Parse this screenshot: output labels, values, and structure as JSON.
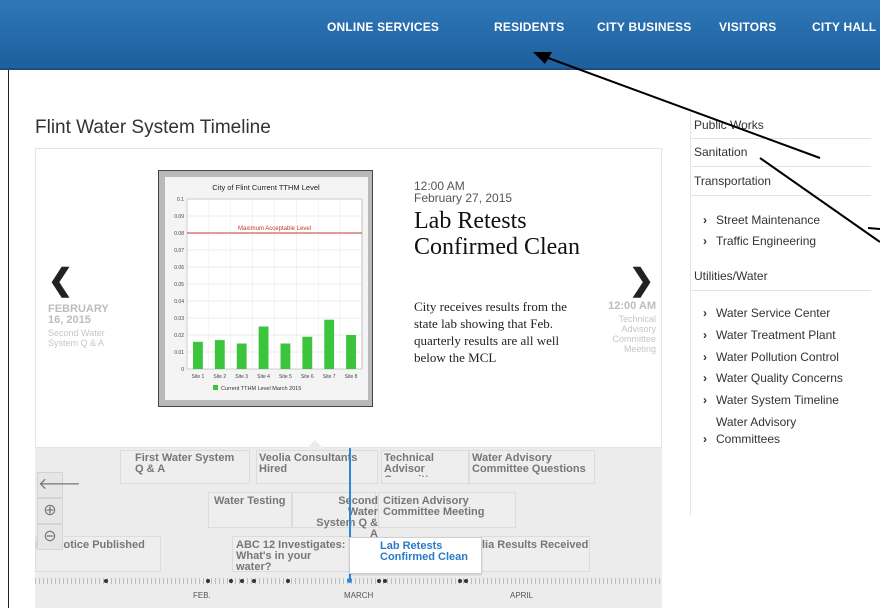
{
  "nav": {
    "items": [
      "ONLINE SERVICES",
      "RESIDENTS",
      "CITY BUSINESS",
      "VISITORS",
      "CITY HALL"
    ]
  },
  "page": {
    "title": "Flint Water System Timeline"
  },
  "slide": {
    "prev": {
      "month_day": "FEBRUARY",
      "year": "16, 2015",
      "caption": "Second Water\nSystem Q & A"
    },
    "next": {
      "time": "12:00 AM",
      "caption": "Technical\nAdvisory\nCommittee\nMeeting"
    },
    "time": "12:00 AM",
    "date": "February 27, 2015",
    "heading": "Lab Retests Confirmed Clean",
    "body": "City receives results from the state lab showing that Feb. quarterly results are all well below the MCL"
  },
  "chart_data": {
    "type": "bar",
    "title": "City of Flint     Current TTHM Level",
    "categories": [
      "Site 1",
      "Site 2",
      "Site 3",
      "Site 4",
      "Site 5",
      "Site 6",
      "Site 7",
      "Site 8"
    ],
    "values": [
      0.016,
      0.017,
      0.015,
      0.025,
      0.015,
      0.019,
      0.029,
      0.02
    ],
    "ylim": [
      0,
      0.1
    ],
    "yticks": [
      "0",
      "0.01",
      "0.02",
      "0.03",
      "0.04",
      "0.05",
      "0.06",
      "0.07",
      "0.08",
      "0.09",
      "0.1"
    ],
    "reference_line": {
      "value": 0.08,
      "label": "Maximum Acceptable Level",
      "color": "#c0392b"
    },
    "series": [
      {
        "name": "Current TTHM Level March 2015",
        "color": "#3cc53c"
      }
    ],
    "legend_label": "Current TTHM Level March 2015",
    "grid": true
  },
  "timeline": {
    "events": [
      "First Water System Q & A",
      "Veolia Consultants Hired",
      "Technical Advisor Committee Meetin",
      "Water Advisory Committee Questions",
      "Water Testing",
      "Second Water System Q & A",
      "Citizen Advisory Committee Meeting",
      "ion Notice Published",
      "ABC 12 Investigates: What's in your water?",
      "lia Results Received"
    ],
    "active_event": "Lab Retests Confirmed Clean",
    "months": [
      "FEB.",
      "MARCH",
      "APRIL"
    ]
  },
  "sidebar": {
    "sections": [
      "Public Works",
      "Sanitation",
      "Transportation"
    ],
    "transportation_items": [
      "Street Maintenance",
      "Traffic Engineering"
    ],
    "utilities_heading": "Utilities/Water",
    "utilities_items": [
      "Water Service Center",
      "Water Treatment Plant",
      "Water Pollution Control",
      "Water Quality Concerns",
      "Water System Timeline"
    ],
    "advisory_line1": "Water Advisory",
    "advisory_line2": "Committees"
  },
  "colors": {
    "nav_bg": "#2f78b7",
    "accent": "#2f86d6",
    "bar": "#3cc53c",
    "limit": "#c0392b"
  },
  "icons": [
    "chevron-left-icon",
    "chevron-right-icon",
    "back-arrow-icon",
    "zoom-in-icon",
    "zoom-out-icon"
  ]
}
